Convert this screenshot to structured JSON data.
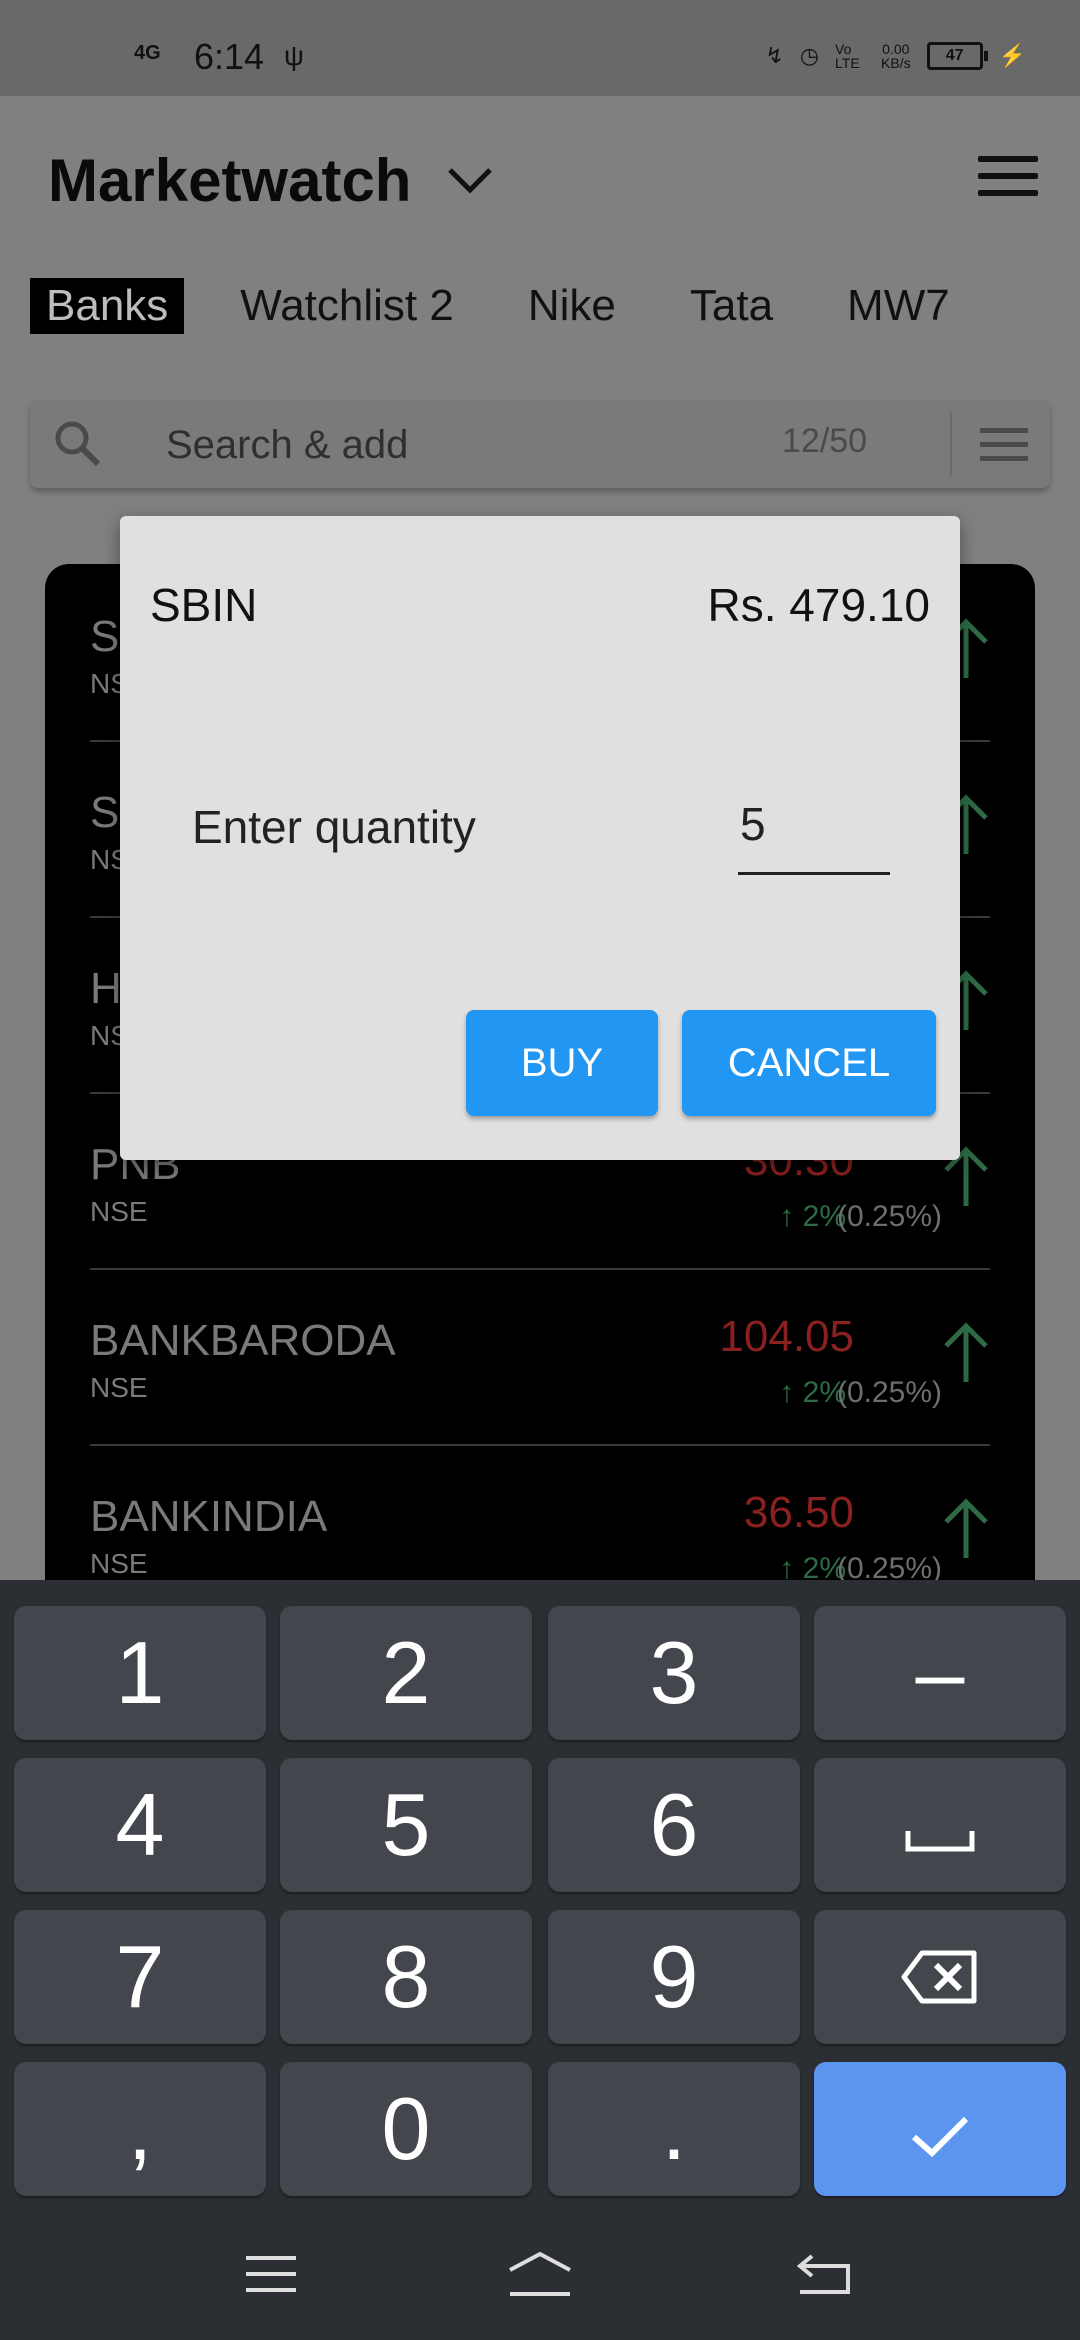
{
  "status_bar": {
    "time": "6:14",
    "network": "4G",
    "data_rate": "0.00",
    "data_unit": "KB/s",
    "volte": "Vo LTE",
    "battery": "47"
  },
  "header": {
    "title": "Marketwatch",
    "tabs": [
      {
        "label": "Banks",
        "active": true
      },
      {
        "label": "Watchlist 2"
      },
      {
        "label": "Nike"
      },
      {
        "label": "Tata"
      },
      {
        "label": "MW7"
      }
    ]
  },
  "search": {
    "placeholder": "Search & add",
    "count": "12/50"
  },
  "watchlist": {
    "rows": [
      {
        "symbol": "S",
        "exchange": "NS",
        "price": "",
        "change": "",
        "pct": ""
      },
      {
        "symbol": "S",
        "exchange": "NS",
        "price": "",
        "change": "",
        "pct": ""
      },
      {
        "symbol": "H",
        "exchange": "NS",
        "price": "",
        "change": "",
        "pct": ""
      },
      {
        "symbol": "PNB",
        "exchange": "NSE",
        "price": "30.30",
        "change": "↑ 2%",
        "pct": "(0.25%)"
      },
      {
        "symbol": "BANKBARODA",
        "exchange": "NSE",
        "price": "104.05",
        "change": "↑ 2%",
        "pct": "(0.25%)"
      },
      {
        "symbol": "BANKINDIA",
        "exchange": "NSE",
        "price": "36.50",
        "change": "↑ 2%",
        "pct": "(0.25%)"
      }
    ]
  },
  "dialog": {
    "symbol": "SBIN",
    "price": "Rs. 479.10",
    "quantity_label": "Enter quantity",
    "quantity_value": "5",
    "buy_label": "BUY",
    "cancel_label": "CANCEL"
  },
  "keyboard": {
    "row1": [
      "1",
      "2",
      "3",
      "–"
    ],
    "row2": [
      "4",
      "5",
      "6",
      "space"
    ],
    "row3": [
      "7",
      "8",
      "9",
      "backspace"
    ],
    "row4": [
      ",",
      "0",
      ".",
      "enter"
    ]
  },
  "colors": {
    "accent": "#2196f3",
    "price_red": "#8b2020",
    "up_green": "#2e6b45",
    "enter_key": "#5b95f0"
  }
}
